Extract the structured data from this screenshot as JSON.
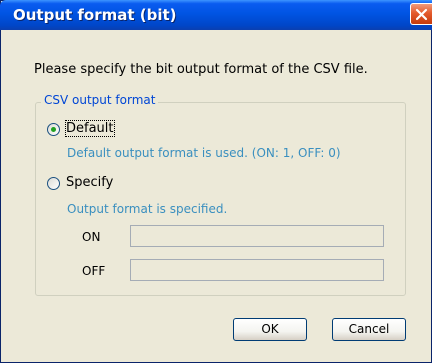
{
  "window": {
    "title": "Output format (bit)",
    "close_icon": "close-icon"
  },
  "prompt": "Please specify the bit output format of the CSV file.",
  "group": {
    "legend": "CSV output format"
  },
  "options": {
    "default": {
      "label": "Default",
      "description": "Default output format is used. (ON: 1, OFF: 0)",
      "selected": true
    },
    "specify": {
      "label": "Specify",
      "description": "Output format is specified.",
      "selected": false
    }
  },
  "fields": {
    "on": {
      "label": "ON",
      "value": ""
    },
    "off": {
      "label": "OFF",
      "value": ""
    }
  },
  "buttons": {
    "ok": "OK",
    "cancel": "Cancel"
  },
  "colors": {
    "titlebar": "#0054e3",
    "legend_text": "#0046d5",
    "description_text": "#3a8fbf",
    "dialog_background": "#ece9d8",
    "close_button": "#e45a2c"
  }
}
